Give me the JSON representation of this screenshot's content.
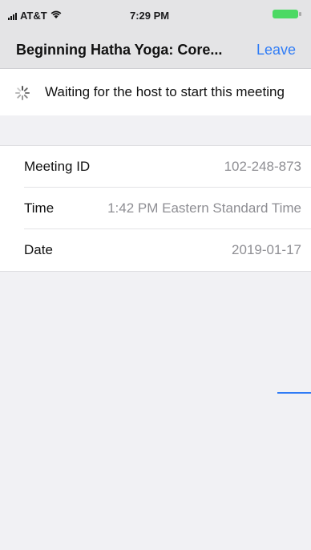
{
  "status_bar": {
    "carrier": "AT&T",
    "time": "7:29 PM"
  },
  "nav": {
    "title": "Beginning Hatha Yoga: Core...",
    "leave_label": "Leave"
  },
  "waiting": {
    "message": "Waiting for the host to start this meeting"
  },
  "meeting": {
    "id_label": "Meeting ID",
    "id_value": "102-248-873",
    "time_label": "Time",
    "time_value": "1:42 PM Eastern Standard Time",
    "date_label": "Date",
    "date_value": "2019-01-17"
  },
  "colors": {
    "accent": "#2f7cf6",
    "battery": "#4cd964"
  }
}
